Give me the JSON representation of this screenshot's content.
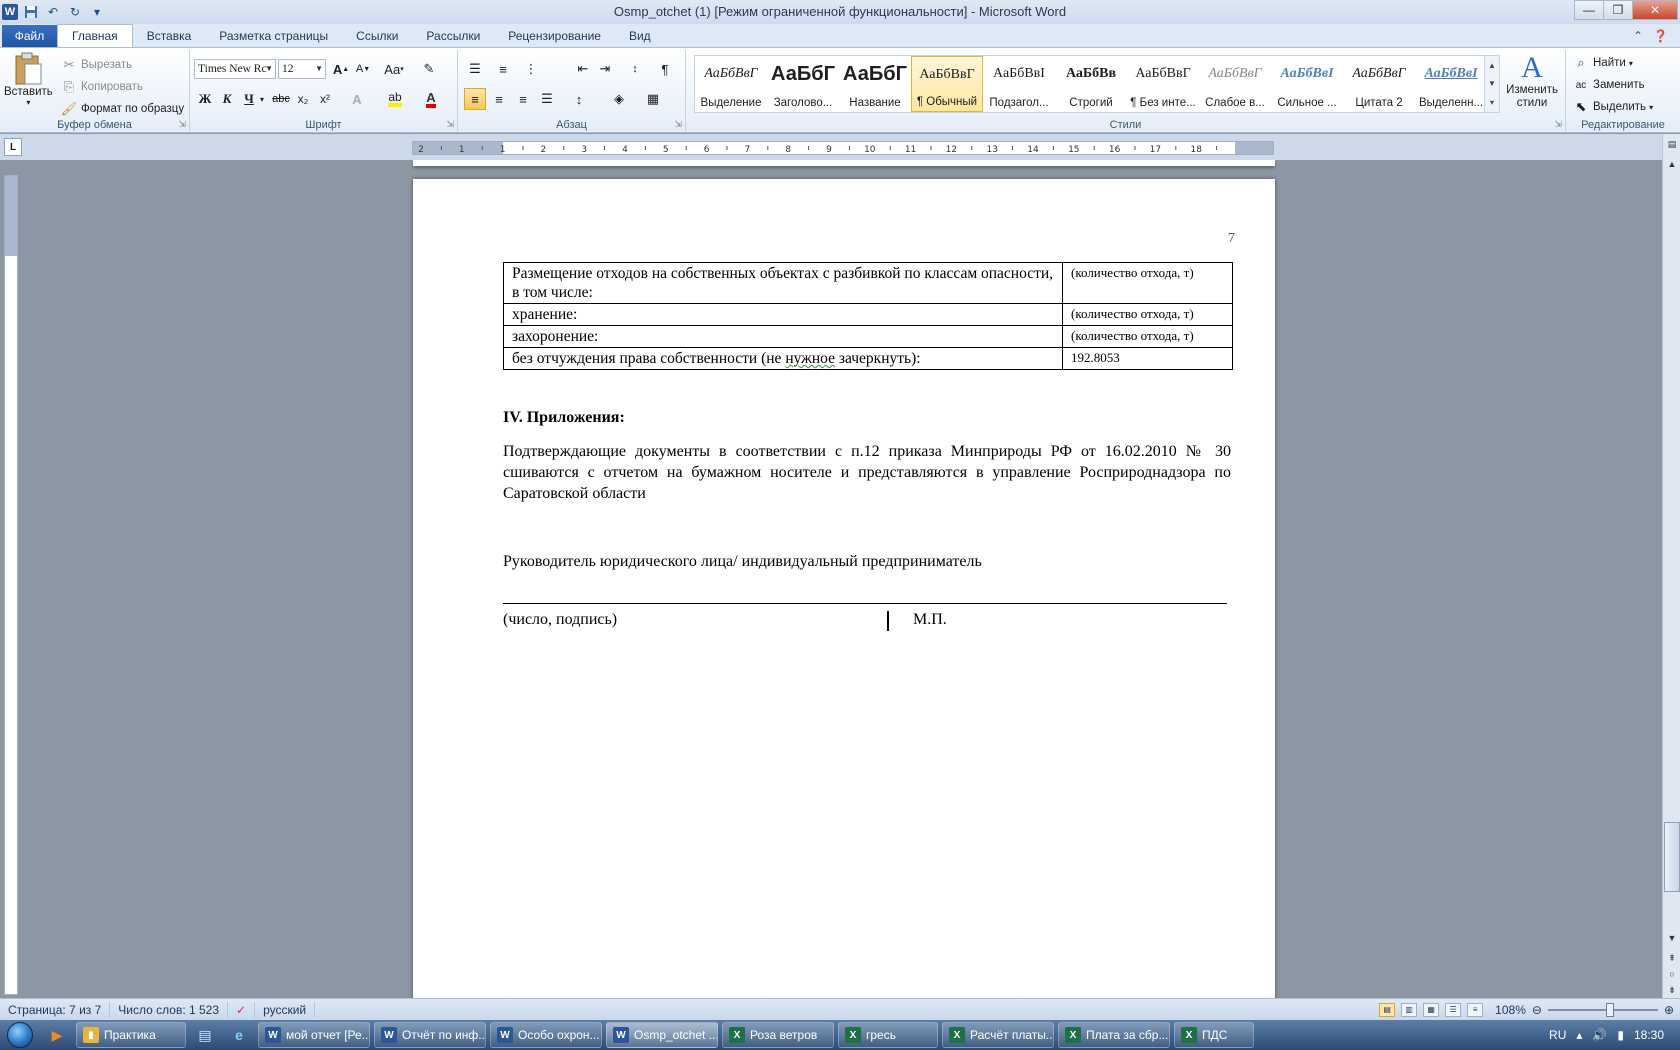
{
  "window": {
    "title": "Osmp_otchet (1) [Режим ограниченной функциональности]  -  Microsoft Word",
    "minimize_glyph": "—",
    "maximize_glyph": "❐",
    "close_glyph": "✕"
  },
  "qat": {
    "logo": "W",
    "save_icon": "save-icon",
    "undo_icon": "undo-icon",
    "redo_icon": "redo-icon"
  },
  "tabs": [
    {
      "label": "Файл"
    },
    {
      "label": "Главная"
    },
    {
      "label": "Вставка"
    },
    {
      "label": "Разметка страницы"
    },
    {
      "label": "Ссылки"
    },
    {
      "label": "Рассылки"
    },
    {
      "label": "Рецензирование"
    },
    {
      "label": "Вид"
    }
  ],
  "ribbon": {
    "clipboard": {
      "label": "Буфер обмена",
      "paste": "Вставить",
      "cut": "Вырезать",
      "copy": "Копировать",
      "format_painter": "Формат по образцу"
    },
    "font": {
      "label": "Шрифт",
      "font_name": "Times New Rc",
      "font_size": "12",
      "bold": "Ж",
      "italic": "К",
      "underline": "Ч",
      "strike": "abc",
      "subscript": "x₂",
      "superscript": "x²",
      "grow": "A",
      "shrink": "A",
      "case": "Aa"
    },
    "paragraph": {
      "label": "Абзац"
    },
    "styles": {
      "label": "Стили",
      "items": [
        {
          "sample": "АаБбВвГ",
          "label": "Выделение"
        },
        {
          "sample": "АаБбГ",
          "label": "Заголово..."
        },
        {
          "sample": "АаБбГ",
          "label": "Название"
        },
        {
          "sample": "АаБбВвГ",
          "label": "¶ Обычный"
        },
        {
          "sample": "АаБбВвІ",
          "label": "Подзагол..."
        },
        {
          "sample": "АаБбВв",
          "label": "Строгий"
        },
        {
          "sample": "АаБбВвГ",
          "label": "¶ Без инте..."
        },
        {
          "sample": "АаБбВвГ",
          "label": "Слабое в..."
        },
        {
          "sample": "АаБбВвІ",
          "label": "Сильное ..."
        },
        {
          "sample": "АаБбВвГ",
          "label": "Цитата 2"
        },
        {
          "sample": "АаБбВвІ",
          "label": "Выделенн..."
        }
      ],
      "change_styles": "Изменить стили"
    },
    "editing": {
      "label": "Редактирование",
      "find": "Найти",
      "replace": "Заменить",
      "select": "Выделить"
    }
  },
  "ruler_numbers": [
    "2",
    "1",
    "1",
    "2",
    "3",
    "4",
    "5",
    "6",
    "7",
    "8",
    "9",
    "10",
    "11",
    "12",
    "13",
    "14",
    "15",
    "16",
    "17",
    "18"
  ],
  "document": {
    "page_number": "7",
    "table": [
      {
        "label": "Размещение отходов на собственных объектах с разбивкой по классам опасности, в том числе:",
        "value": "(количество отхода, т)"
      },
      {
        "label": "хранение:",
        "value": "(количество отхода, т)"
      },
      {
        "label": "захоронение:",
        "value": "(количество отхода, т)"
      },
      {
        "label_pre": "без отчуждения права собственности (не ",
        "label_err": "нужное",
        "label_post": " зачеркнуть):",
        "value": "192.8053"
      }
    ],
    "section_heading": "IV. Приложения:",
    "paragraph": "Подтверждающие документы в соответствии с п.12 приказа Минприроды РФ от 16.02.2010 № 30 сшиваются с отчетом на бумажном носителе и представляются в управление Росприроднадзора по Саратовской области",
    "head_line": "Руководитель юридического лица/ индивидуальный предприниматель",
    "sign_caption": "(число, подпись)",
    "mp": "М.П."
  },
  "status": {
    "page": "Страница: 7 из 7",
    "words": "Число слов: 1 523",
    "language": "русский",
    "zoom": "108%"
  },
  "taskbar": {
    "items": [
      {
        "label": "Практика",
        "icon": "folder-icon",
        "color": "#e8b640",
        "glyph": "▮"
      },
      {
        "label": "мой отчет [Ре...",
        "icon": "word-icon",
        "color": "#2b579a",
        "glyph": "W"
      },
      {
        "label": "Отчёт по инф...",
        "icon": "word-icon",
        "color": "#2b579a",
        "glyph": "W"
      },
      {
        "label": "Особо охрон...",
        "icon": "word-icon",
        "color": "#2b579a",
        "glyph": "W"
      },
      {
        "label": "Osmp_otchet ...",
        "icon": "word-icon",
        "color": "#2b579a",
        "glyph": "W"
      },
      {
        "label": "Роза ветров",
        "icon": "excel-icon",
        "color": "#1e7145",
        "glyph": "X"
      },
      {
        "label": "гресь",
        "icon": "excel-icon",
        "color": "#1e7145",
        "glyph": "X"
      },
      {
        "label": "Расчёт платы...",
        "icon": "excel-icon",
        "color": "#1e7145",
        "glyph": "X"
      },
      {
        "label": "Плата за сбр...",
        "icon": "excel-icon",
        "color": "#1e7145",
        "glyph": "X"
      },
      {
        "label": "ПДС",
        "icon": "excel-icon",
        "color": "#1e7145",
        "glyph": "X"
      }
    ],
    "lang": "RU",
    "clock": "18:30"
  }
}
